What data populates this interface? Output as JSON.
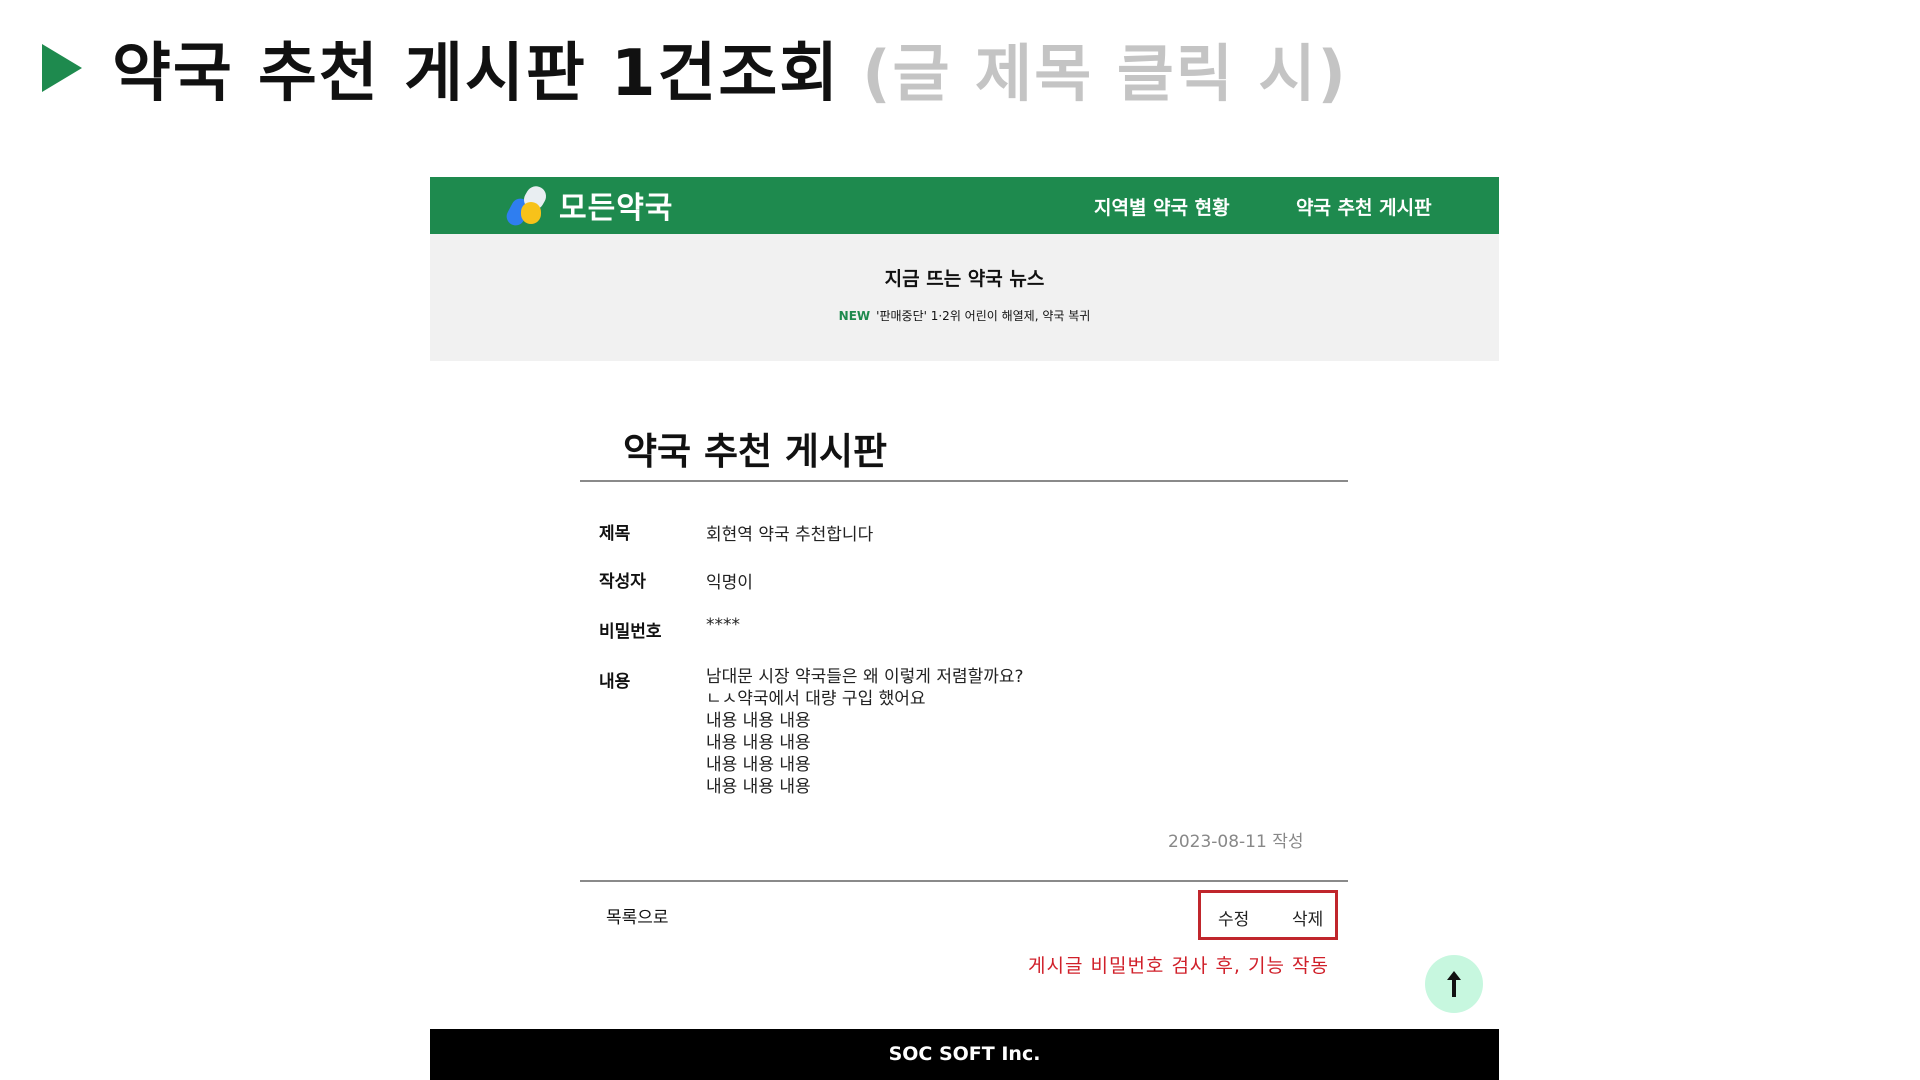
{
  "slide": {
    "title": "약국 추천 게시판 1건조회",
    "subtitle": "(글 제목 클릭 시)"
  },
  "site": {
    "brand": "모든약국",
    "nav": {
      "region_status": "지역별 약국 현황",
      "recommend_board": "약국 추천 게시판"
    },
    "news": {
      "title": "지금 뜨는 약국 뉴스",
      "badge": "NEW",
      "headline": "'판매중단' 1·2위 어린이 해열제, 약국 복귀"
    },
    "board": {
      "title": "약국 추천 게시판",
      "fields": {
        "title_label": "제목",
        "title_value": "회현역 약국 추천합니다",
        "author_label": "작성자",
        "author_value": "익명이",
        "password_label": "비밀번호",
        "password_value": "****",
        "content_label": "내용",
        "content_lines": [
          "남대문 시장 약국들은 왜 이렇게 저렴할까요?",
          "ㄴㅅ약국에서 대량 구입 했어요",
          "내용 내용 내용",
          "내용 내용 내용",
          "내용 내용 내용",
          "내용 내용 내용"
        ]
      },
      "date": "2023-08-11 작성",
      "list_link": "목록으로",
      "edit_button": "수정",
      "delete_button": "삭제",
      "note": "게시글 비밀번호 검사 후, 기능 작동"
    },
    "footer": "SOC SOFT Inc.",
    "colors": {
      "brand_green": "#1e8a4e",
      "highlight_red": "#c0262c",
      "top_button_bg": "#c7f7df"
    },
    "icons": {
      "top_button": "arrow-up-icon",
      "slide_marker": "play-triangle-icon"
    }
  }
}
